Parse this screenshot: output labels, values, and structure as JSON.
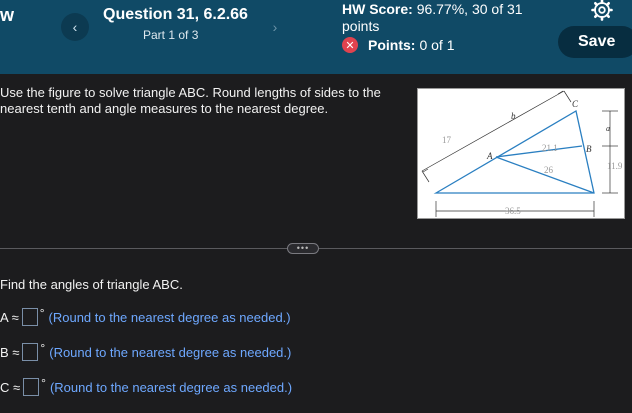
{
  "header": {
    "brand": "w",
    "question_title": "Question 31, 6.2.66",
    "question_part": "Part 1 of 3",
    "prev_glyph": "‹",
    "next_glyph": "›",
    "hw_score_label": "HW Score:",
    "hw_score_value": "96.77%, 30 of 31 points",
    "points_label": "Points:",
    "points_value": "0 of 1",
    "save_label": "Save"
  },
  "prompt": "Use the figure to solve triangle ABC. Round lengths of sides to the nearest tenth and angle measures to the nearest degree.",
  "figure": {
    "labels": {
      "a": "a",
      "b": "b",
      "c": "C",
      "A": "A",
      "B": "B"
    },
    "values": {
      "v17": "17",
      "v211": "21.1",
      "v26": "26",
      "v119": "11.9",
      "v365": "36.5"
    }
  },
  "divider_handle": "•••",
  "instruction": "Find the angles of triangle ABC.",
  "answers": [
    {
      "label": "A ≈",
      "hint": "(Round to the nearest degree as needed.)"
    },
    {
      "label": "B ≈",
      "hint": "(Round to the nearest degree as needed.)"
    },
    {
      "label": "C ≈",
      "hint": "(Round to the nearest degree as needed.)"
    }
  ],
  "degree_symbol": "°"
}
